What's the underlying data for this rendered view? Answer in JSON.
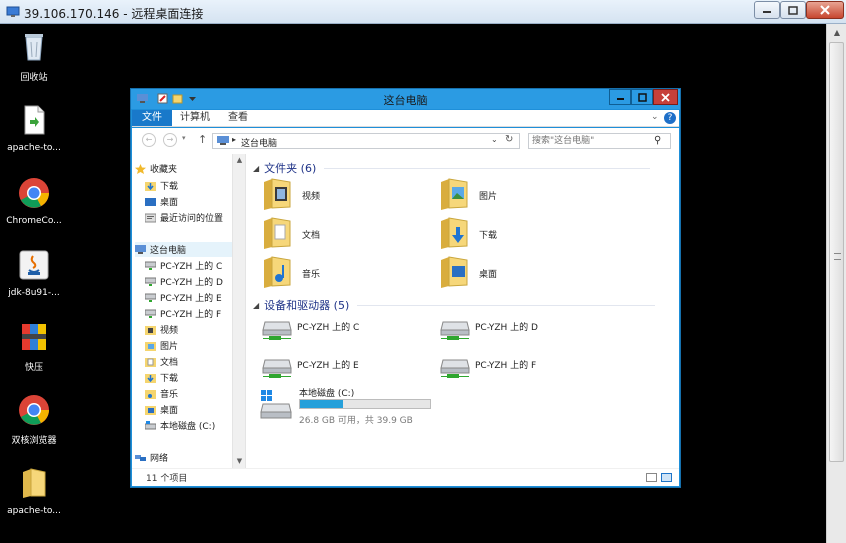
{
  "rdp": {
    "title": "39.106.170.146 - 远程桌面连接",
    "buttons": {
      "minimize": "—",
      "maximize": "▭",
      "close": "✕"
    }
  },
  "desktop": {
    "icons": [
      {
        "label": "回收站",
        "icon": "recycle-bin-icon"
      },
      {
        "label": "apache-to...",
        "icon": "file-icon"
      },
      {
        "label": "ChromeCo...",
        "icon": "chrome-icon"
      },
      {
        "label": "jdk-8u91-...",
        "icon": "java-icon"
      },
      {
        "label": "快压",
        "icon": "archive-icon"
      },
      {
        "label": "双核浏览器",
        "icon": "browser-icon"
      },
      {
        "label": "apache-to...",
        "icon": "folder-icon"
      }
    ]
  },
  "explorer": {
    "title": "这台电脑",
    "ribbon_tabs": [
      "文件",
      "计算机",
      "查看"
    ],
    "address": "这台电脑",
    "search_placeholder": "搜索\"这台电脑\"",
    "nav": {
      "favorites_label": "收藏夹",
      "favorites": [
        "下载",
        "桌面",
        "最近访问的位置"
      ],
      "this_pc_label": "这台电脑",
      "this_pc_items": [
        "PC-YZH 上的 C",
        "PC-YZH 上的 D",
        "PC-YZH 上的 E",
        "PC-YZH 上的 F",
        "视频",
        "图片",
        "文档",
        "下载",
        "音乐",
        "桌面",
        "本地磁盘 (C:)"
      ],
      "network_label": "网络"
    },
    "folders_header": "文件夹 (6)",
    "folders": [
      "视频",
      "图片",
      "文档",
      "下载",
      "音乐",
      "桌面"
    ],
    "devices_header": "设备和驱动器 (5)",
    "network_drives": [
      "PC-YZH 上的 C",
      "PC-YZH 上的 D",
      "PC-YZH 上的 E",
      "PC-YZH 上的 F"
    ],
    "local_disk": {
      "name": "本地磁盘 (C:)",
      "info": "26.8 GB 可用，共 39.9 GB",
      "used_fraction": 0.33
    },
    "status_count": "11 个项目"
  }
}
